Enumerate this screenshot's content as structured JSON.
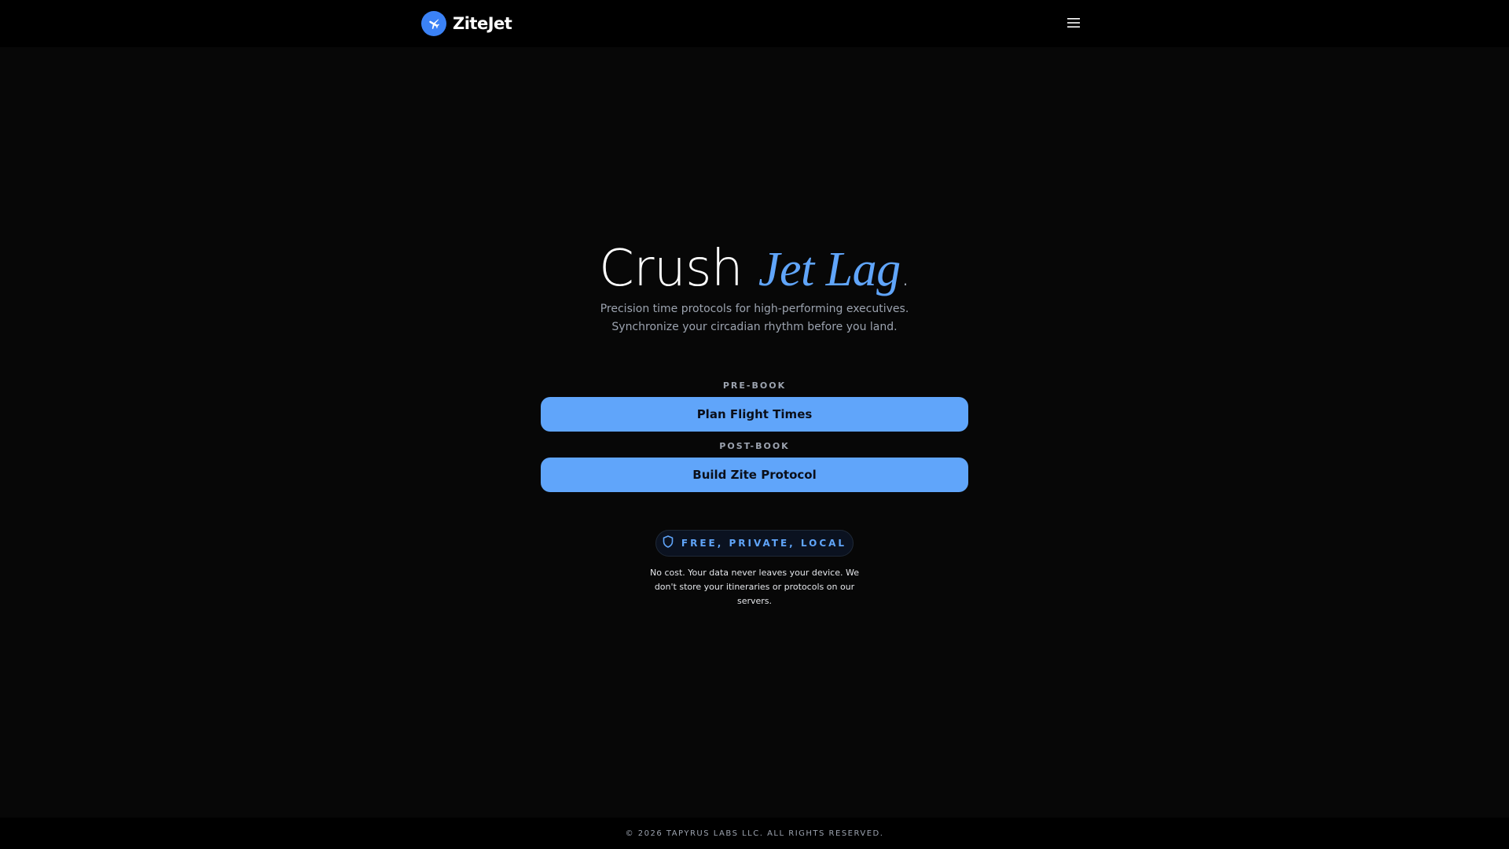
{
  "header": {
    "brand_name": "ZiteJet",
    "logo_icon": "airplane-icon",
    "menu_icon": "hamburger-menu-icon"
  },
  "hero": {
    "title_main": "Crush ",
    "title_accent": "Jet Lag",
    "title_dot": ".",
    "subtitle": "Precision time protocols for high-performing executives. Synchronize your circadian rhythm before you land."
  },
  "actions": {
    "prebook_label": "PRE-BOOK",
    "plan_button_label": "Plan Flight Times",
    "postbook_label": "POST-BOOK",
    "build_button_label": "Build Zite Protocol"
  },
  "privacy": {
    "badge_icon": "shield-icon",
    "badge_text": "FREE, PRIVATE, LOCAL",
    "note": "No cost. Your data never leaves your device. We don't store your itineraries or protocols on our servers."
  },
  "footer": {
    "copyright": "© 2026 TAPYRUS LABS LLC. ALL RIGHTS RESERVED."
  },
  "colors": {
    "accent": "#60a5fa",
    "logo_bg": "#3b82f6",
    "background": "#070707",
    "header_bg": "#000000"
  }
}
